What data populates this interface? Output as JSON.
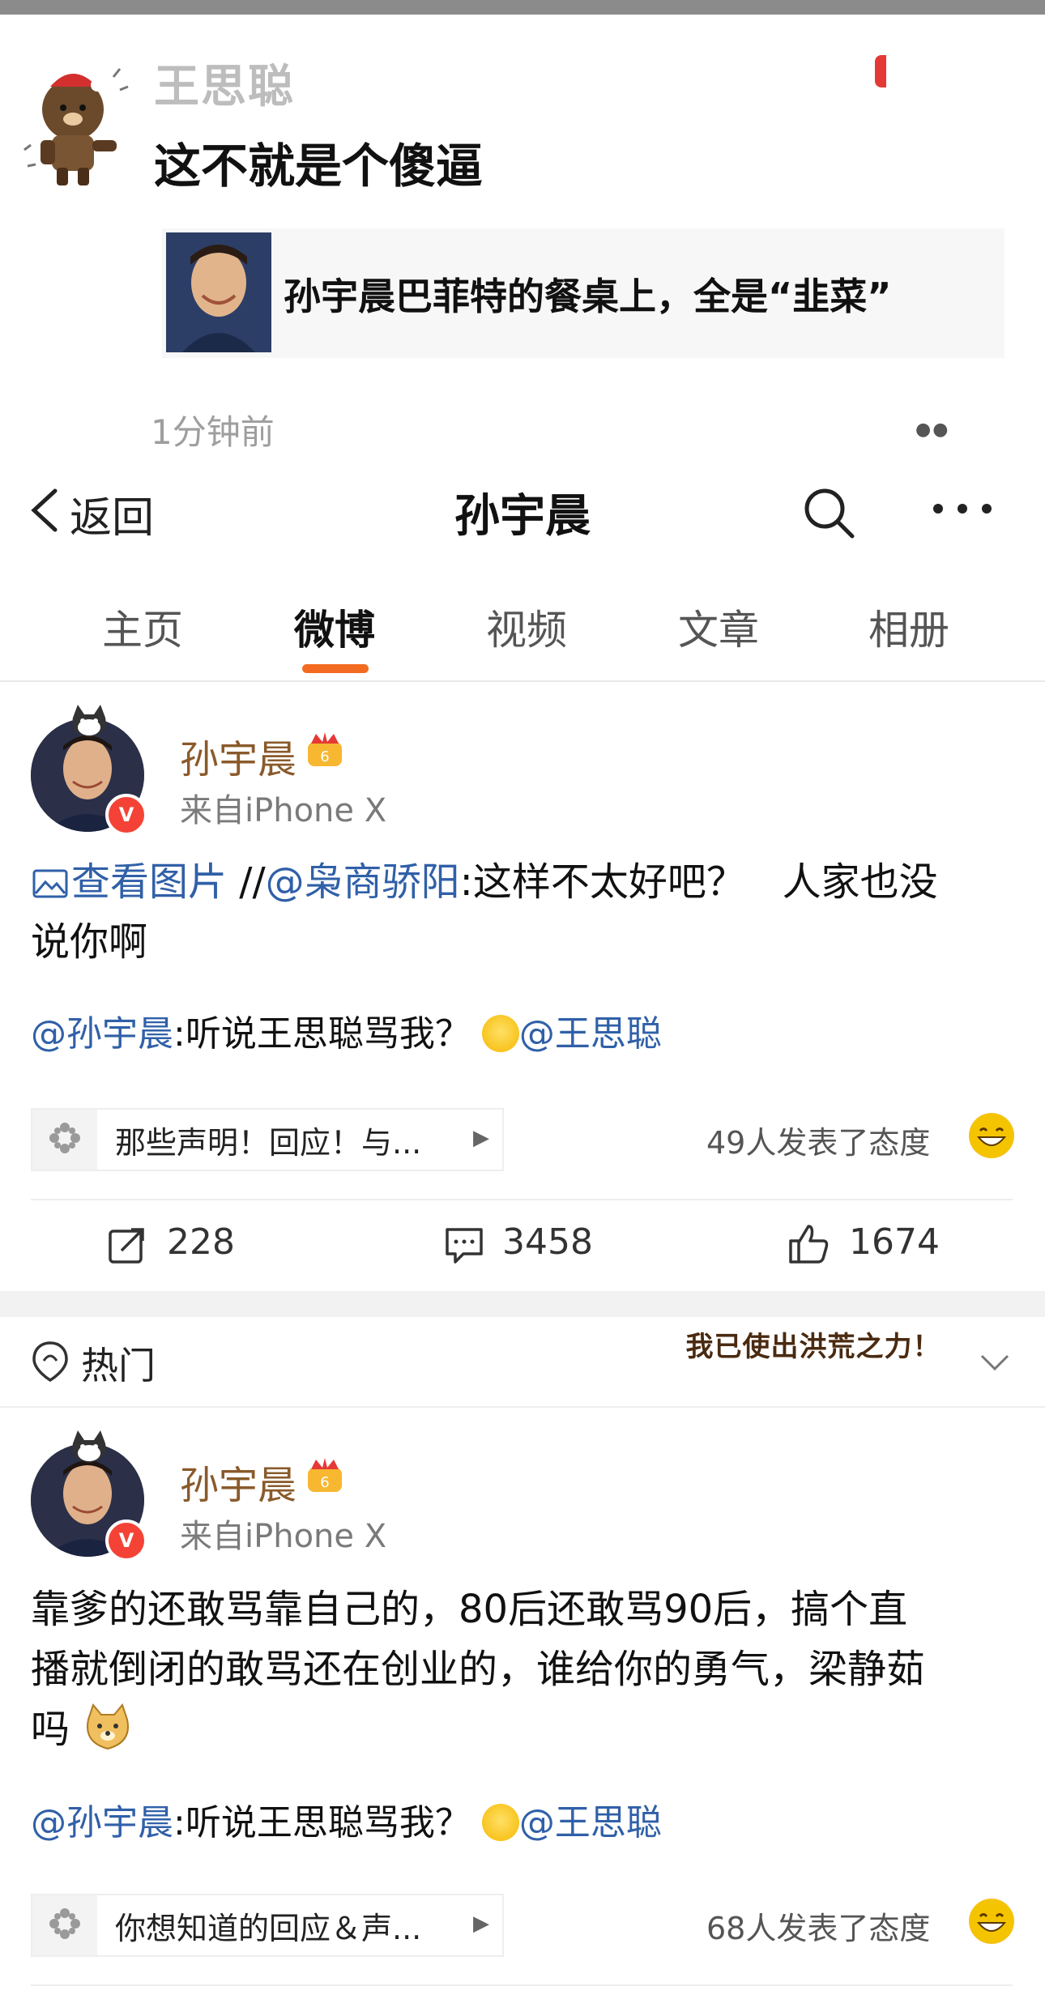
{
  "overlay": {
    "commenter_name": "王思聪",
    "comment_text": "这不就是个傻逼",
    "quoted_title": "孙宇晨巴菲特的餐桌上，全是“韭菜”",
    "time_ago": "1分钟前"
  },
  "nav": {
    "back_label": "返回",
    "title": "孙宇晨",
    "search_icon": "search-icon",
    "more_icon": "more-icon"
  },
  "tabs": [
    "主页",
    "微博",
    "视频",
    "文章",
    "相册"
  ],
  "active_tab": 1,
  "colors": {
    "accent": "#f36b21",
    "link": "#3060a8",
    "username": "#8a5a2b",
    "verified": "#f44336"
  },
  "posts": [
    {
      "author": "孙宇晨",
      "source": "来自iPhone X",
      "view_image": "查看图片",
      "retweet_sep": " //",
      "mention": "@枭商骄阳",
      "text_line1": ":这样不太好吧？   人家也没",
      "text_line2": "说你啊",
      "reply_mention": "@孙宇晨",
      "reply_text": ":听说王思聪骂我？",
      "reply_mention2": "@王思聪",
      "topic": "那些声明！回应！与...",
      "attitude": "49人发表了态度",
      "reposts": "228",
      "comments": "3458",
      "likes": "1674"
    },
    {
      "author": "孙宇晨",
      "source": "来自iPhone X",
      "text_line1": "靠爹的还敢骂靠自己的，80后还敢骂90后，搞个直",
      "text_line2": "播就倒闭的敢骂还在创业的，谁给你的勇气，梁静茹",
      "text_line3": "吗",
      "reply_mention": "@孙宇晨",
      "reply_text": ":听说王思聪骂我？",
      "reply_mention2": "@王思聪",
      "topic": "你想知道的回应＆声...",
      "attitude": "68人发表了态度"
    }
  ],
  "hot": {
    "label": "热门",
    "banner": "我已使出洪荒之力！"
  }
}
